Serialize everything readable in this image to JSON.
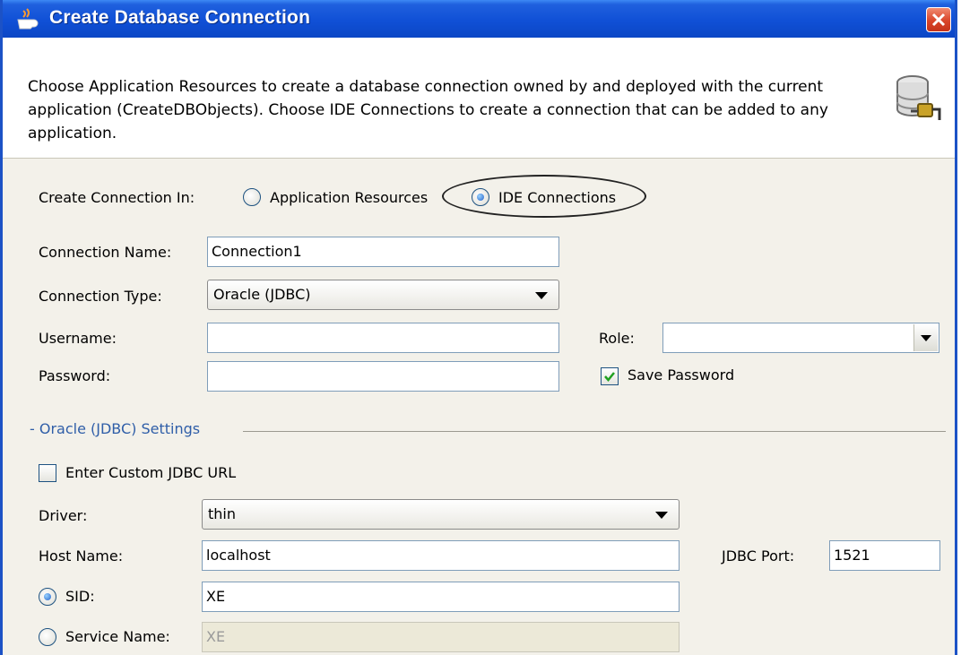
{
  "window": {
    "title": "Create Database Connection"
  },
  "header": {
    "description": "Choose Application Resources to create a database connection owned by and deployed with the current application (CreateDBObjects). Choose IDE Connections to create a connection that can be added to any application."
  },
  "create_in": {
    "label": "Create Connection In:",
    "options": [
      "Application Resources",
      "IDE Connections"
    ],
    "selected": "IDE Connections"
  },
  "connection_name": {
    "label": "Connection Name:",
    "value": "Connection1"
  },
  "connection_type": {
    "label": "Connection Type:",
    "value": "Oracle (JDBC)"
  },
  "username": {
    "label": "Username:",
    "value": ""
  },
  "password": {
    "label": "Password:",
    "value": ""
  },
  "role": {
    "label": "Role:",
    "value": ""
  },
  "save_password": {
    "label": "Save Password",
    "checked": true
  },
  "settings": {
    "title": "- Oracle (JDBC) Settings",
    "custom_url": {
      "label": "Enter Custom JDBC URL",
      "checked": false
    },
    "driver": {
      "label": "Driver:",
      "value": "thin"
    },
    "host": {
      "label": "Host Name:",
      "value": "localhost"
    },
    "port": {
      "label": "JDBC Port:",
      "value": "1521"
    },
    "sid": {
      "label": "SID:",
      "value": "XE",
      "selected": true
    },
    "service_name": {
      "label": "Service Name:",
      "value": "XE",
      "selected": false
    }
  },
  "colors": {
    "titlebar": "#1050d6",
    "section_title": "#2f5ea8",
    "close_button": "#d9452a"
  }
}
